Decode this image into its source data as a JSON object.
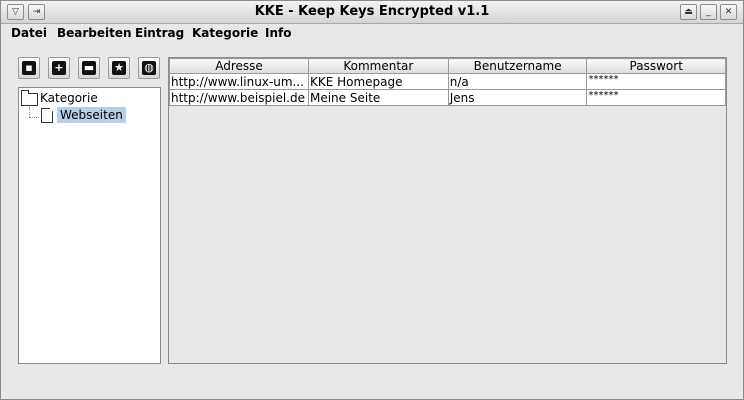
{
  "window": {
    "title": "KKE - Keep Keys Encrypted v1.1",
    "left_buttons": [
      "menu-icon",
      "pin-icon"
    ],
    "right_buttons": [
      "shade-icon",
      "minimize-icon",
      "close-icon"
    ]
  },
  "menubar": {
    "items": [
      "Datei",
      "Bearbeiten",
      "Eintrag",
      "Kategorie",
      "Info"
    ]
  },
  "toolbar": {
    "icons": [
      "save-icon",
      "add-icon",
      "monitor-icon",
      "star-icon",
      "globe-icon"
    ]
  },
  "tree": {
    "root": "Kategorie",
    "children": [
      "Webseiten"
    ],
    "selected": "Webseiten"
  },
  "table": {
    "columns": [
      "Adresse",
      "Kommentar",
      "Benutzername",
      "Passwort"
    ],
    "rows": [
      [
        "http://www.linux-um...",
        "KKE Homepage",
        "n/a",
        "******"
      ],
      [
        "http://www.beispiel.de",
        "Meine Seite",
        "Jens",
        "******"
      ]
    ]
  }
}
